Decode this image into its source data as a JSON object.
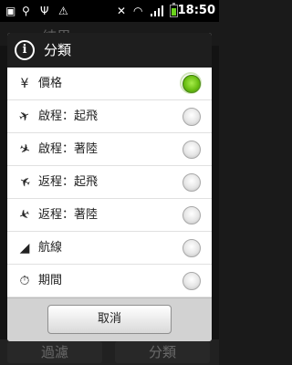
{
  "statusbar": {
    "time": "18:50"
  },
  "background": {
    "title": "結果",
    "bottom_buttons": [
      "過濾",
      "分類"
    ]
  },
  "dialog": {
    "title": "分類",
    "options": [
      {
        "label": "價格",
        "icon": "yen-icon",
        "glyph": "¥",
        "selected": true
      },
      {
        "label": "啟程：起飛",
        "icon": "plane-takeoff-icon",
        "glyph": "✈",
        "selected": false
      },
      {
        "label": "啟程：著陸",
        "icon": "plane-landing-icon",
        "glyph": "✈",
        "selected": false
      },
      {
        "label": "返程：起飛",
        "icon": "plane-takeoff-icon",
        "glyph": "✈",
        "selected": false
      },
      {
        "label": "返程：著陸",
        "icon": "plane-landing-icon",
        "glyph": "✈",
        "selected": false
      },
      {
        "label": "航線",
        "icon": "airline-icon",
        "glyph": "◢",
        "selected": false
      },
      {
        "label": "期間",
        "icon": "stopwatch-icon",
        "glyph": "⏱",
        "selected": false
      }
    ],
    "cancel_label": "取消"
  },
  "colors": {
    "selected_radio": "#6cc014",
    "header_bg": "#1e1e1e",
    "battery": "#6ad21c"
  }
}
